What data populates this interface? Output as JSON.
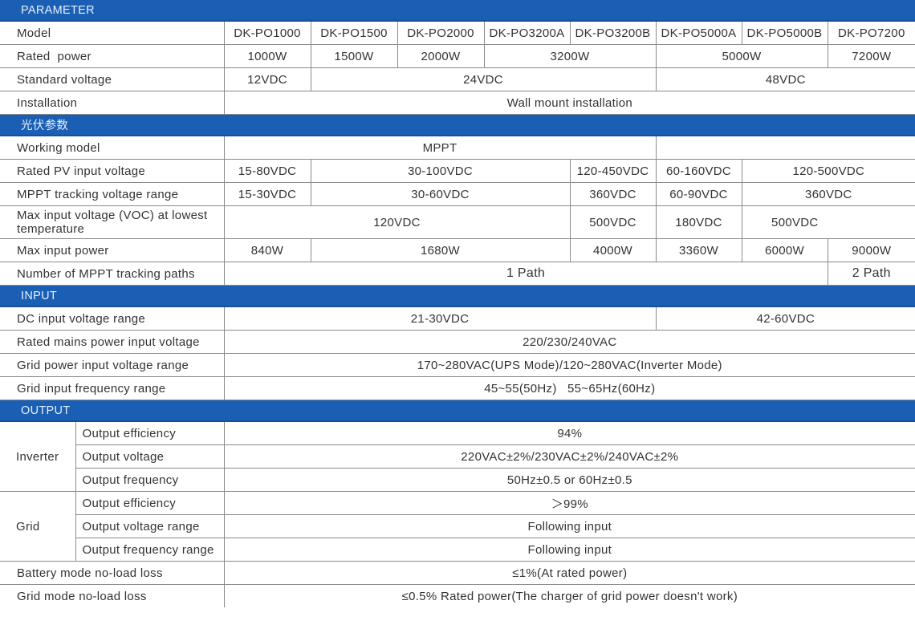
{
  "sections": {
    "parameter": "PARAMETER",
    "pv": "光伏参数",
    "input": "INPUT",
    "output": "OUTPUT"
  },
  "parameter": {
    "model": {
      "label": "Model",
      "values": [
        "DK-PO1000",
        "DK-PO1500",
        "DK-PO2000",
        "DK-PO3200A",
        "DK-PO3200B",
        "DK-PO5000A",
        "DK-PO5000B",
        "DK-PO7200"
      ]
    },
    "rated_power": {
      "label": "Rated  power",
      "values": [
        "1000W",
        "1500W",
        "2000W",
        "3200W",
        "5000W",
        "7200W"
      ]
    },
    "standard_voltage": {
      "label": "Standard voltage",
      "values": [
        "12VDC",
        "24VDC",
        "48VDC"
      ]
    },
    "installation": {
      "label": "Installation",
      "value": "Wall mount installation"
    }
  },
  "pv": {
    "working_model": {
      "label": "Working model",
      "values": [
        "MPPT",
        ""
      ]
    },
    "rated_pv_input": {
      "label": "Rated PV input voltage",
      "values": [
        "15-80VDC",
        "30-100VDC",
        "120-450VDC",
        "60-160VDC",
        "120-500VDC"
      ]
    },
    "mppt_range": {
      "label": "MPPT tracking voltage range",
      "values": [
        "15-30VDC",
        "30-60VDC",
        "360VDC",
        "60-90VDC",
        "360VDC"
      ]
    },
    "max_voc": {
      "label": "Max input voltage (VOC) at lowest temperature",
      "values": [
        "120VDC",
        "500VDC",
        "180VDC",
        "500VDC"
      ]
    },
    "max_input_power": {
      "label": "Max input power",
      "values": [
        "840W",
        "1680W",
        "4000W",
        "3360W",
        "6000W",
        "9000W"
      ]
    },
    "mppt_paths": {
      "label": "Number of MPPT tracking paths",
      "values": [
        "1 Path",
        "2 Path"
      ]
    }
  },
  "input": {
    "dc_range": {
      "label": "DC input voltage range",
      "values": [
        "21-30VDC",
        "42-60VDC"
      ]
    },
    "rated_mains": {
      "label": "Rated mains power input voltage",
      "value": "220/230/240VAC"
    },
    "grid_range": {
      "label": "Grid power input voltage range",
      "value": "170~280VAC(UPS Mode)/120~280VAC(Inverter Mode)"
    },
    "grid_freq": {
      "label": "Grid input frequency range",
      "value": "45~55(50Hz)   55~65Hz(60Hz)"
    }
  },
  "output": {
    "inverter": {
      "group": "Inverter",
      "rows": [
        {
          "label": "Output efficiency",
          "value": "94%"
        },
        {
          "label": "Output voltage",
          "value": "220VAC±2%/230VAC±2%/240VAC±2%"
        },
        {
          "label": "Output frequency",
          "value": "50Hz±0.5 or 60Hz±0.5"
        }
      ]
    },
    "grid": {
      "group": "Grid",
      "rows": [
        {
          "label": "Output efficiency",
          "value": "＞99%"
        },
        {
          "label": "Output voltage range",
          "value": "Following input"
        },
        {
          "label": "Output frequency range",
          "value": "Following input"
        }
      ]
    },
    "battery_loss": {
      "label": "Battery mode no-load loss",
      "value": "≤1%(At rated power)"
    },
    "grid_loss": {
      "label": "Grid mode no-load loss",
      "value": "≤0.5% Rated power(The charger of grid power doesn't work)"
    }
  }
}
